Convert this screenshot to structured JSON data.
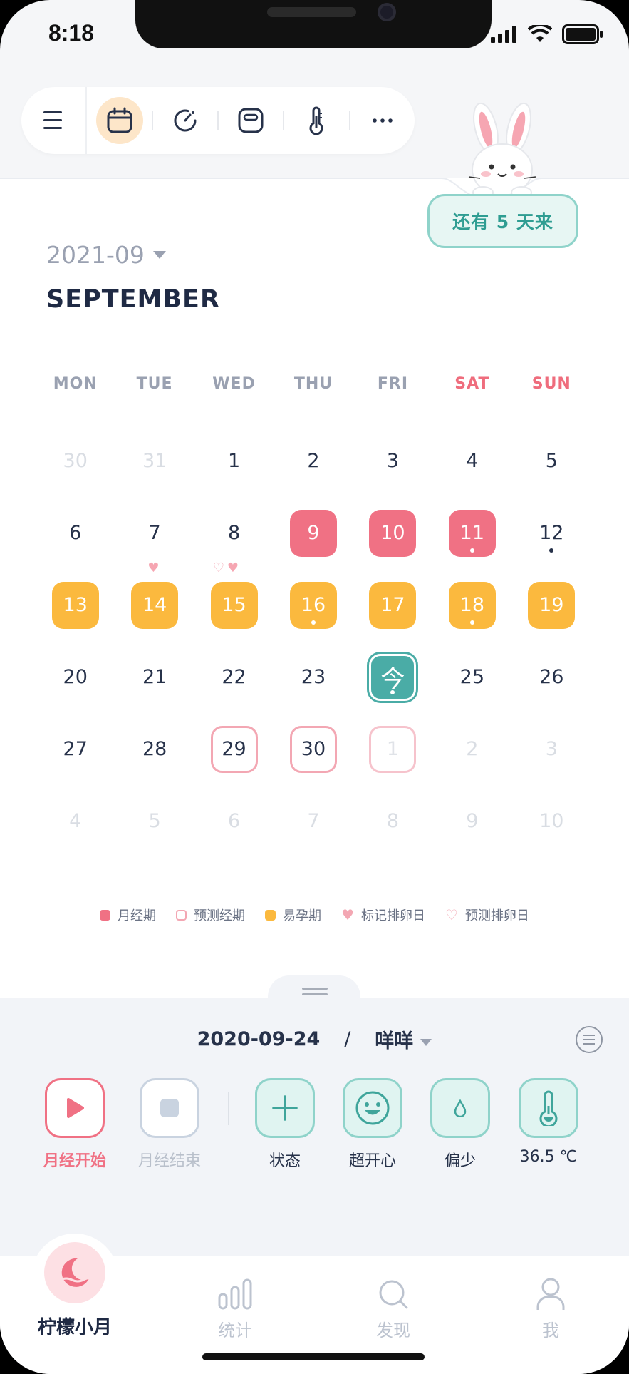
{
  "status_bar": {
    "time": "8:18"
  },
  "toolbar": {
    "items": [
      {
        "icon": "menu-icon"
      },
      {
        "icon": "calendar-icon",
        "active": true
      },
      {
        "icon": "timer-icon"
      },
      {
        "icon": "scale-icon"
      },
      {
        "icon": "thermometer-icon"
      },
      {
        "icon": "more-icon"
      }
    ]
  },
  "reminder": {
    "text": "还有 5 天来"
  },
  "calendar": {
    "month_number": "2021-09",
    "month_name": "SEPTEMBER",
    "weekdays": [
      "MON",
      "TUE",
      "WED",
      "THU",
      "FRI",
      "SAT",
      "SUN"
    ],
    "days": [
      {
        "n": "30",
        "t": "muted"
      },
      {
        "n": "31",
        "t": "muted"
      },
      {
        "n": "1",
        "t": ""
      },
      {
        "n": "2",
        "t": ""
      },
      {
        "n": "3",
        "t": ""
      },
      {
        "n": "4",
        "t": ""
      },
      {
        "n": "5",
        "t": ""
      },
      {
        "n": "6",
        "t": ""
      },
      {
        "n": "7",
        "t": ""
      },
      {
        "n": "8",
        "t": ""
      },
      {
        "n": "9",
        "t": "period"
      },
      {
        "n": "10",
        "t": "period"
      },
      {
        "n": "11",
        "t": "period",
        "dot": true
      },
      {
        "n": "12",
        "t": "",
        "dot": true
      },
      {
        "n": "13",
        "t": "fertile"
      },
      {
        "n": "14",
        "t": "fertile",
        "hearts": "f"
      },
      {
        "n": "15",
        "t": "fertile",
        "hearts": "of"
      },
      {
        "n": "16",
        "t": "fertile",
        "dot": true
      },
      {
        "n": "17",
        "t": "fertile"
      },
      {
        "n": "18",
        "t": "fertile",
        "dot": true
      },
      {
        "n": "19",
        "t": "fertile"
      },
      {
        "n": "20",
        "t": ""
      },
      {
        "n": "21",
        "t": ""
      },
      {
        "n": "22",
        "t": ""
      },
      {
        "n": "23",
        "t": ""
      },
      {
        "n": "今",
        "t": "today",
        "dot": true
      },
      {
        "n": "25",
        "t": ""
      },
      {
        "n": "26",
        "t": ""
      },
      {
        "n": "27",
        "t": ""
      },
      {
        "n": "28",
        "t": ""
      },
      {
        "n": "29",
        "t": "predict"
      },
      {
        "n": "30",
        "t": "predict"
      },
      {
        "n": "1",
        "t": "predict m"
      },
      {
        "n": "2",
        "t": "muted"
      },
      {
        "n": "3",
        "t": "muted"
      },
      {
        "n": "4",
        "t": "muted"
      },
      {
        "n": "5",
        "t": "muted"
      },
      {
        "n": "6",
        "t": "muted"
      },
      {
        "n": "7",
        "t": "muted"
      },
      {
        "n": "8",
        "t": "muted"
      },
      {
        "n": "9",
        "t": "muted"
      },
      {
        "n": "10",
        "t": "muted"
      }
    ]
  },
  "legend": [
    {
      "label": "月经期",
      "kind": "period"
    },
    {
      "label": "预测经期",
      "kind": "predict"
    },
    {
      "label": "易孕期",
      "kind": "fertile"
    },
    {
      "label": "标记排卵日",
      "kind": "heart-filled"
    },
    {
      "label": "预测排卵日",
      "kind": "heart-outline"
    }
  ],
  "record": {
    "date": "2020-09-24",
    "separator": "/",
    "user": "咩咩"
  },
  "actions": [
    {
      "label": "月经开始",
      "icon": "play-icon"
    },
    {
      "label": "月经结束",
      "icon": "stop-icon"
    },
    {
      "label": "状态",
      "icon": "plus-icon"
    },
    {
      "label": "超开心",
      "icon": "smile-icon"
    },
    {
      "label": "偏少",
      "icon": "drop-icon"
    },
    {
      "label": "36.5 ℃",
      "icon": "thermometer-icon"
    }
  ],
  "tabs": [
    {
      "label": "柠檬小月",
      "icon": "moon-icon",
      "active": true
    },
    {
      "label": "统计",
      "icon": "chart-icon"
    },
    {
      "label": "发现",
      "icon": "search-icon"
    },
    {
      "label": "我",
      "icon": "person-icon"
    }
  ],
  "colors": {
    "period": "#f07184",
    "fertile": "#fbb93e",
    "today": "#4aaca6",
    "accent_teal": "#8fd3ca"
  }
}
